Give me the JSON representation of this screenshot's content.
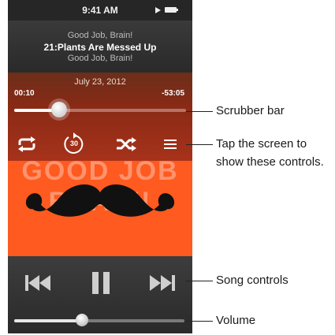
{
  "status_bar": {
    "time": "9:41 AM",
    "play_icon": "play-indicator-icon",
    "battery_icon": "battery-icon"
  },
  "track": {
    "artist": "Good Job, Brain!",
    "title": "21:Plants Are Messed Up",
    "album": "Good Job, Brain!",
    "date": "July 23, 2012"
  },
  "scrubber": {
    "elapsed": "00:10",
    "remaining": "-53:05",
    "progress": 0.26
  },
  "controls": {
    "repeat": "repeat-icon",
    "skip30": "30",
    "shuffle": "shuffle-icon",
    "menu": "menu-icon"
  },
  "album_art": {
    "text": "GOOD JOB BRAIN!",
    "image": "mustache-image"
  },
  "song_controls": {
    "previous": "previous-icon",
    "pause": "pause-icon",
    "next": "next-icon"
  },
  "volume": {
    "level": 0.4
  },
  "callouts": {
    "scrubber": "Scrubber bar",
    "tap_line1": "Tap the screen to",
    "tap_line2": "show these controls.",
    "song_controls": "Song controls",
    "volume": "Volume"
  },
  "colors": {
    "overlay": "#8a2a16",
    "art_background": "#ff5a1f",
    "panel": "#333333"
  }
}
